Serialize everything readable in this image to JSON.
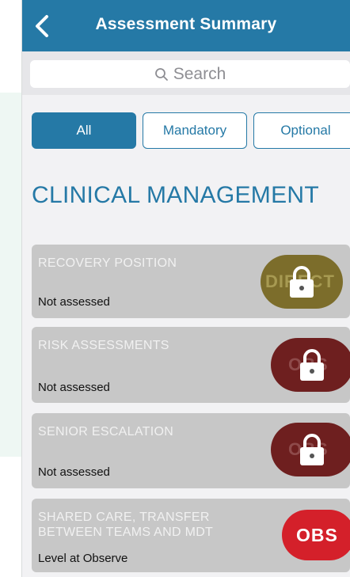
{
  "header": {
    "title": "Assessment Summary"
  },
  "search": {
    "placeholder": "Search"
  },
  "filters": {
    "all": "All",
    "mandatory": "Mandatory",
    "optional": "Optional"
  },
  "section": {
    "title": "CLINICAL MANAGEMENT"
  },
  "cards": [
    {
      "name": "RECOVERY POSITION",
      "status": "Not assessed",
      "badge": "DIRECT",
      "badge_color": "#7c6d2b",
      "locked": true
    },
    {
      "name": "RISK ASSESSMENTS",
      "status": "Not assessed",
      "badge": "OBS",
      "badge_color": "#6e1f1f",
      "locked": true
    },
    {
      "name": "SENIOR ESCALATION",
      "status": "Not assessed",
      "badge": "OBS",
      "badge_color": "#6e1f1f",
      "locked": true
    },
    {
      "name": "SHARED CARE, TRANSFER BETWEEN TEAMS AND MDT",
      "status": "Level at Observe",
      "badge": "OBS",
      "badge_color": "#d4202a",
      "locked": false
    }
  ],
  "colors": {
    "primary": "#2579a6",
    "card_bg": "#c7c7c7"
  },
  "icons": {
    "back": "chevron-left-icon",
    "search": "search-icon",
    "lock": "padlock-icon"
  }
}
